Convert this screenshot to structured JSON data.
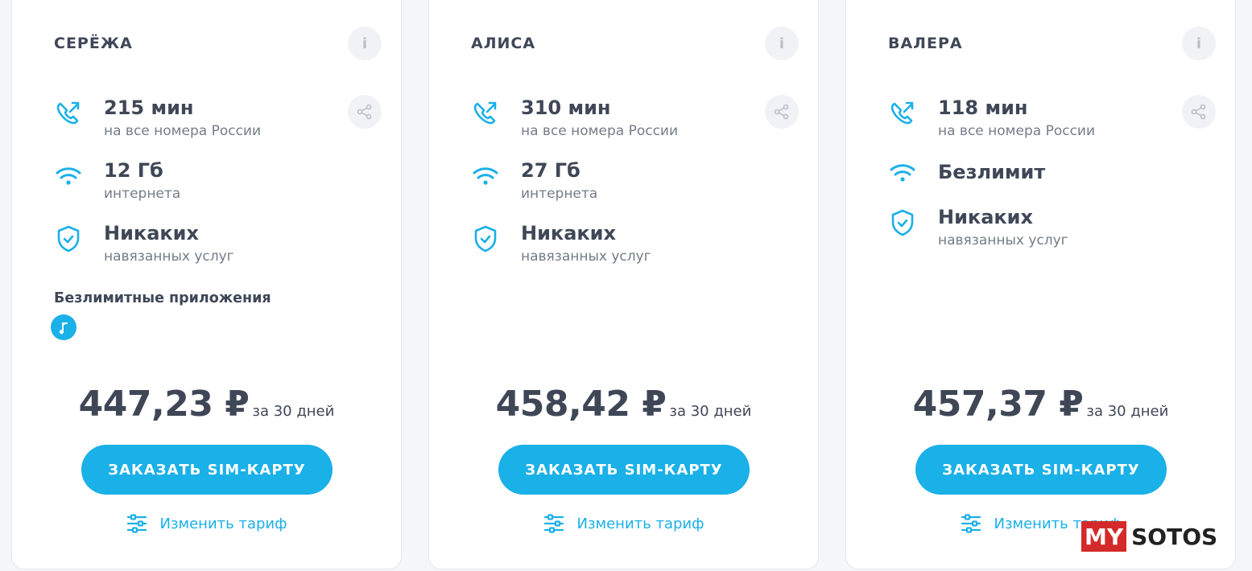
{
  "accent_color": "#1ab0e8",
  "cards": [
    {
      "name": "СЕРЁЖА",
      "minutes": "215 мин",
      "minutes_sub": "на все номера России",
      "internet": "12 Гб",
      "internet_sub": "интернета",
      "services": "Никаких",
      "services_sub": "навязанных услуг",
      "apps_label": "Безлимитные приложения",
      "apps": [
        "music-icon"
      ],
      "price": "447,23 ₽",
      "period": "за 30 дней",
      "order_button": "ЗАКАЗАТЬ SIM-КАРТУ",
      "change_link": "Изменить тариф"
    },
    {
      "name": "АЛИСА",
      "minutes": "310 мин",
      "minutes_sub": "на все номера России",
      "internet": "27 Гб",
      "internet_sub": "интернета",
      "services": "Никаких",
      "services_sub": "навязанных услуг",
      "price": "458,42 ₽",
      "period": "за 30 дней",
      "order_button": "ЗАКАЗАТЬ SIM-КАРТУ",
      "change_link": "Изменить тариф"
    },
    {
      "name": "ВАЛЕРА",
      "minutes": "118 мин",
      "minutes_sub": "на все номера России",
      "internet": "Безлимит",
      "services": "Никаких",
      "services_sub": "навязанных услуг",
      "price": "457,37 ₽",
      "period": "за 30 дней",
      "order_button": "ЗАКАЗАТЬ SIM-КАРТУ",
      "change_link": "Изменить тариф"
    }
  ],
  "watermark": {
    "my": "MY",
    "sotos": "SOTOS"
  }
}
